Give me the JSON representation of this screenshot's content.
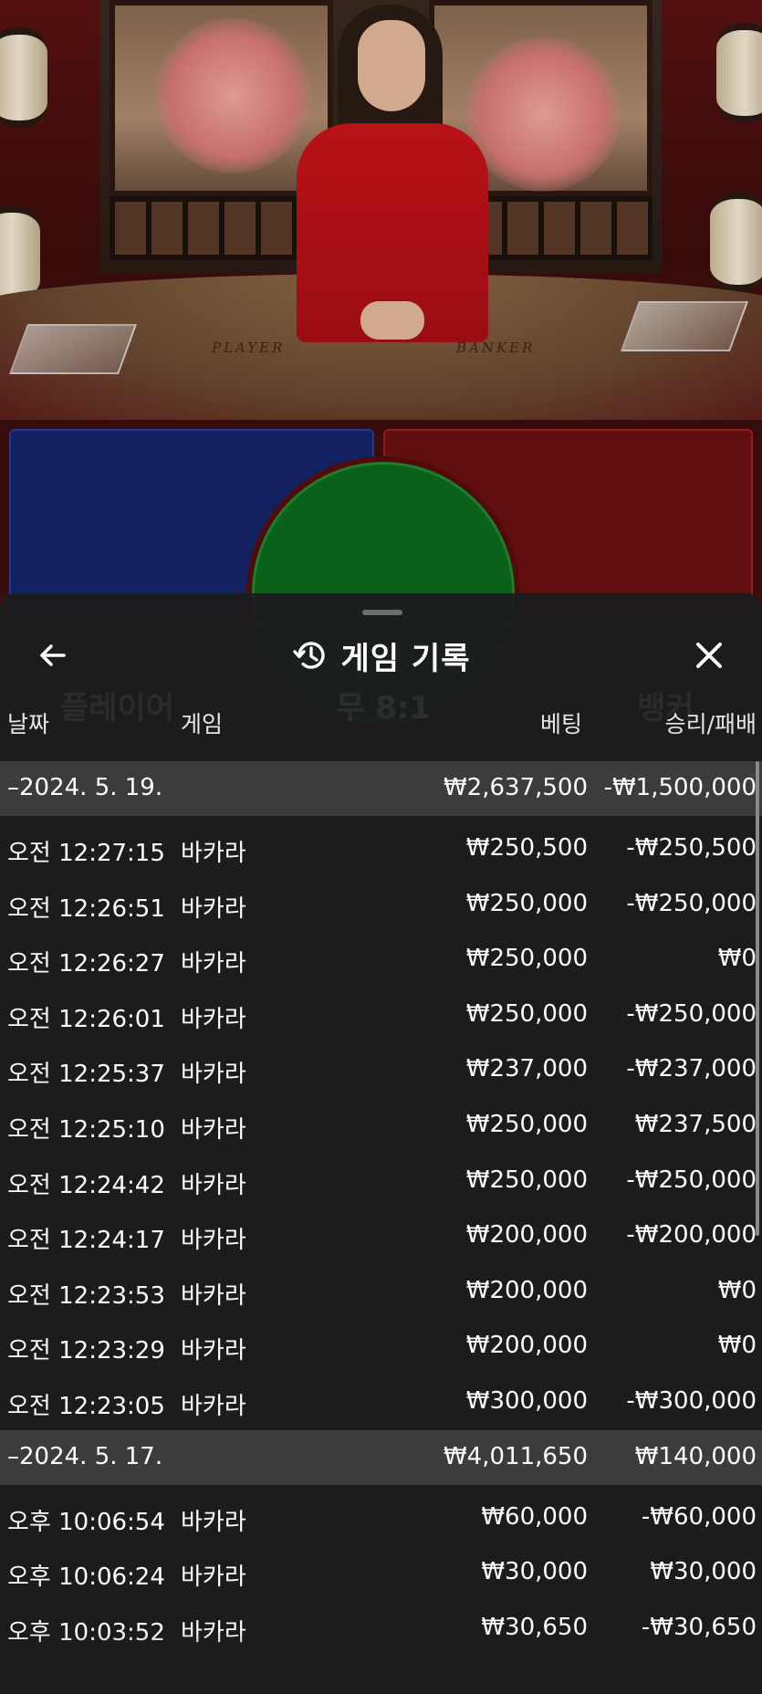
{
  "scene": {
    "table_labels": {
      "player": "PLAYER",
      "banker": "BANKER"
    }
  },
  "panel": {
    "title": "게임 기록",
    "back_icon": "back-arrow-icon",
    "history_icon": "history-icon",
    "close_icon": "close-icon",
    "background_tabs": [
      "플레이어",
      "무 8:1",
      "뱅커"
    ]
  },
  "columns": {
    "date": "날짜",
    "game": "게임",
    "bet": "베팅",
    "result": "승리/패배"
  },
  "groups": [
    {
      "date": "–2024. 5. 19.",
      "bet_total": "₩2,637,500",
      "result_total": "-₩1,500,000",
      "rows": [
        {
          "time": "오전 12:27:15",
          "game": "바카라",
          "bet": "₩250,500",
          "result": "-₩250,500"
        },
        {
          "time": "오전 12:26:51",
          "game": "바카라",
          "bet": "₩250,000",
          "result": "-₩250,000"
        },
        {
          "time": "오전 12:26:27",
          "game": "바카라",
          "bet": "₩250,000",
          "result": "₩0"
        },
        {
          "time": "오전 12:26:01",
          "game": "바카라",
          "bet": "₩250,000",
          "result": "-₩250,000"
        },
        {
          "time": "오전 12:25:37",
          "game": "바카라",
          "bet": "₩237,000",
          "result": "-₩237,000"
        },
        {
          "time": "오전 12:25:10",
          "game": "바카라",
          "bet": "₩250,000",
          "result": "₩237,500"
        },
        {
          "time": "오전 12:24:42",
          "game": "바카라",
          "bet": "₩250,000",
          "result": "-₩250,000"
        },
        {
          "time": "오전 12:24:17",
          "game": "바카라",
          "bet": "₩200,000",
          "result": "-₩200,000"
        },
        {
          "time": "오전 12:23:53",
          "game": "바카라",
          "bet": "₩200,000",
          "result": "₩0"
        },
        {
          "time": "오전 12:23:29",
          "game": "바카라",
          "bet": "₩200,000",
          "result": "₩0"
        },
        {
          "time": "오전 12:23:05",
          "game": "바카라",
          "bet": "₩300,000",
          "result": "-₩300,000"
        }
      ]
    },
    {
      "date": "–2024. 5. 17.",
      "bet_total": "₩4,011,650",
      "result_total": "₩140,000",
      "rows": [
        {
          "time": "오후 10:06:54",
          "game": "바카라",
          "bet": "₩60,000",
          "result": "-₩60,000"
        },
        {
          "time": "오후 10:06:24",
          "game": "바카라",
          "bet": "₩30,000",
          "result": "₩30,000"
        },
        {
          "time": "오후 10:03:52",
          "game": "바카라",
          "bet": "₩30,650",
          "result": "-₩30,650"
        }
      ]
    }
  ]
}
